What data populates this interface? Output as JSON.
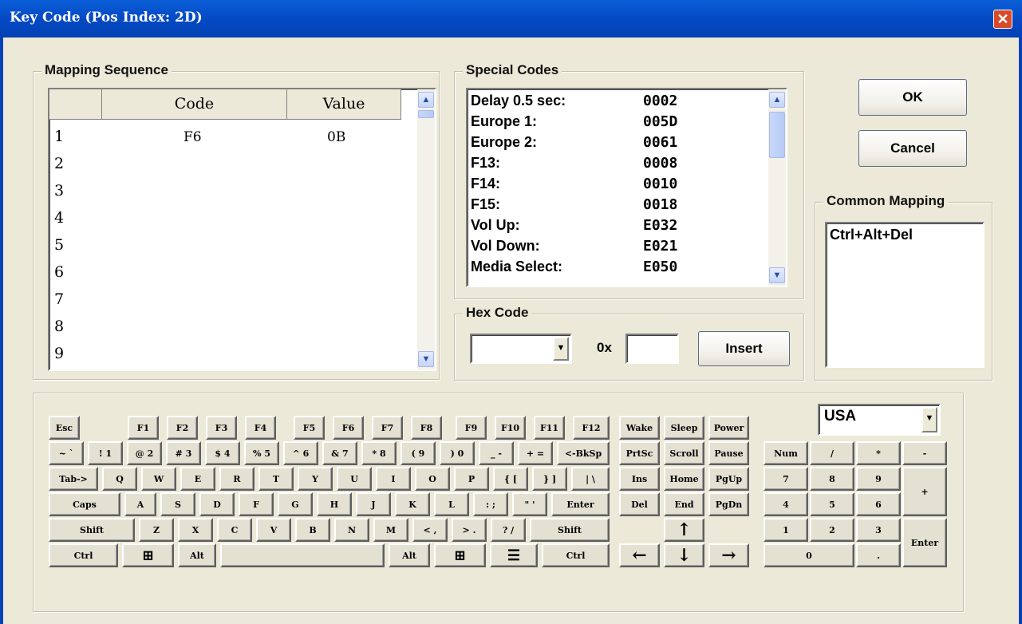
{
  "window": {
    "title": "Key Code (Pos Index: 2D)",
    "close_glyph": "✕"
  },
  "mapping": {
    "label": "Mapping Sequence",
    "headers": [
      "",
      "Code",
      "Value"
    ],
    "rows": [
      "1",
      "2",
      "3",
      "4",
      "5",
      "6",
      "7",
      "8",
      "9"
    ],
    "row1_code": "F6",
    "row1_value": "0B"
  },
  "special": {
    "label": "Special Codes",
    "items": [
      {
        "name": "Delay 0.5 sec:",
        "code": "0002"
      },
      {
        "name": "Europe 1:",
        "code": "005D"
      },
      {
        "name": "Europe 2:",
        "code": "0061"
      },
      {
        "name": "F13:",
        "code": "0008"
      },
      {
        "name": "F14:",
        "code": "0010"
      },
      {
        "name": "F15:",
        "code": "0018"
      },
      {
        "name": "Vol Up:",
        "code": "E032"
      },
      {
        "name": "Vol Down:",
        "code": "E021"
      },
      {
        "name": "Media Select:",
        "code": "E050"
      }
    ]
  },
  "hex": {
    "label": "Hex Code",
    "prefix": "0x",
    "insert": "Insert",
    "value": ""
  },
  "buttons": {
    "ok": "OK",
    "cancel": "Cancel"
  },
  "common": {
    "label": "Common Mapping",
    "items": [
      "Ctrl+Alt+Del"
    ]
  },
  "layout_select": {
    "value": "USA"
  },
  "keys": {
    "esc": "Esc",
    "f1": "F1",
    "f2": "F2",
    "f3": "F3",
    "f4": "F4",
    "f5": "F5",
    "f6": "F6",
    "f7": "F7",
    "f8": "F8",
    "f9": "F9",
    "f10": "F10",
    "f11": "F11",
    "f12": "F12",
    "wake": "Wake",
    "sleep": "Sleep",
    "power": "Power",
    "tilde": "~  `",
    "k1": "!  1",
    "k2": "@ 2",
    "k3": "#  3",
    "k4": "$  4",
    "k5": "%  5",
    "k6": "^  6",
    "k7": "&  7",
    "k8": "*  8",
    "k9": "(  9",
    "k0": ")  0",
    "minus": "_  -",
    "equal": "+  =",
    "bksp": "<-BkSp",
    "prtsc": "PrtSc",
    "scroll": "Scroll",
    "pause": "Pause",
    "num": "Num",
    "div": "/",
    "mul": "*",
    "sub": "-",
    "tab": "Tab->",
    "q": "Q",
    "w": "W",
    "e": "E",
    "r": "R",
    "t": "T",
    "y": "Y",
    "u": "U",
    "i": "I",
    "o": "O",
    "p": "P",
    "lbr": "{  [",
    "rbr": "}  ]",
    "bsl": "|  \\",
    "ins": "Ins",
    "home": "Home",
    "pgup": "PgUp",
    "n7": "7",
    "n8": "8",
    "n9": "9",
    "add": "+",
    "caps": "Caps",
    "a": "A",
    "s": "S",
    "d": "D",
    "f": "F",
    "g": "G",
    "h": "H",
    "j": "J",
    "k": "K",
    "l": "L",
    "semi": ":  ;",
    "quote": "\"  '",
    "enter": "Enter",
    "del": "Del",
    "end": "End",
    "pgdn": "PgDn",
    "n4": "4",
    "n5": "5",
    "n6": "6",
    "lshift": "Shift",
    "z": "Z",
    "x": "X",
    "c": "C",
    "v": "V",
    "b": "B",
    "n": "N",
    "m": "M",
    "comma": "<  ,",
    "period": ">  .",
    "slash": "?  /",
    "rshift": "Shift",
    "up": "↑",
    "n1": "1",
    "n2": "2",
    "n3": "3",
    "nenter": "Enter",
    "lctrl": "Ctrl",
    "lwin": "⊞",
    "lalt": "Alt",
    "space": "",
    "ralt": "Alt",
    "rwin": "⊞",
    "menu": "☰",
    "rctrl": "Ctrl",
    "left": "←",
    "down": "↓",
    "right": "→",
    "n0": "0",
    "ndot": "."
  }
}
